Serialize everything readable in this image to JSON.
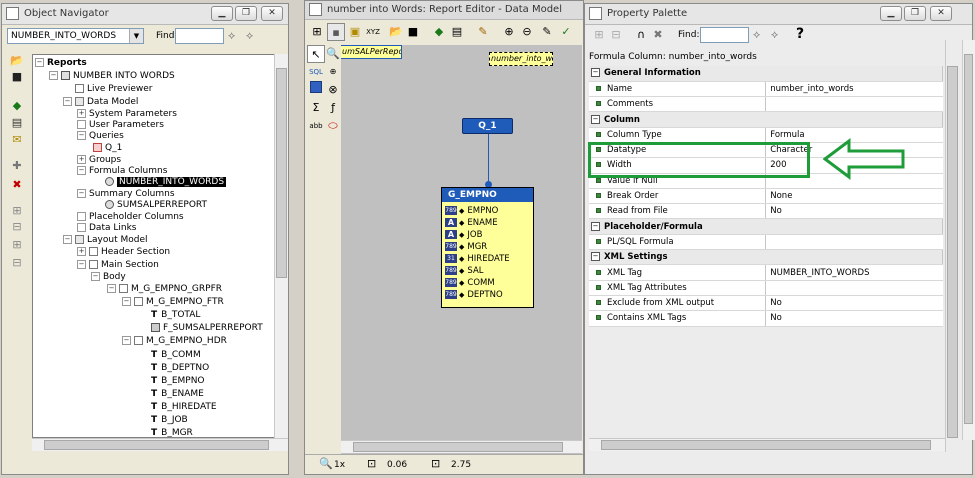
{
  "object_navigator": {
    "title": "Object Navigator",
    "combo_value": "NUMBER_INTO_WORDS",
    "find_label": "Find:",
    "find_value": "",
    "tree": [
      {
        "label": "Reports",
        "bold": true
      },
      {
        "label": "NUMBER INTO WORDS"
      },
      {
        "label": "Live Previewer"
      },
      {
        "label": "Data Model"
      },
      {
        "label": "System Parameters"
      },
      {
        "label": "User Parameters"
      },
      {
        "label": "Queries"
      },
      {
        "label": "Q_1"
      },
      {
        "label": "Groups"
      },
      {
        "label": "Formula Columns"
      },
      {
        "label": "NUMBER_INTO_WORDS",
        "selected": true
      },
      {
        "label": "Summary Columns"
      },
      {
        "label": "SUMSALPERREPORT"
      },
      {
        "label": "Placeholder Columns"
      },
      {
        "label": "Data Links"
      },
      {
        "label": "Layout Model"
      },
      {
        "label": "Header Section"
      },
      {
        "label": "Main Section"
      },
      {
        "label": "Body"
      },
      {
        "label": "M_G_EMPNO_GRPFR"
      },
      {
        "label": "M_G_EMPNO_FTR"
      },
      {
        "label": "B_TOTAL"
      },
      {
        "label": "F_SUMSALPERREPORT"
      },
      {
        "label": "M_G_EMPNO_HDR"
      },
      {
        "label": "B_COMM"
      },
      {
        "label": "B_DEPTNO"
      },
      {
        "label": "B_EMPNO"
      },
      {
        "label": "B_ENAME"
      },
      {
        "label": "B_HIREDATE"
      },
      {
        "label": "B_JOB"
      },
      {
        "label": "B_MGR"
      }
    ]
  },
  "report_editor": {
    "title": "number into Words: Report Editor - Data Model",
    "summary_field": "umSALPerRepo",
    "formula_field": "number_into_wor",
    "query_label": "Q_1",
    "group_title": "G_EMPNO",
    "columns": [
      {
        "name": "EMPNO",
        "type": "789"
      },
      {
        "name": "ENAME",
        "type": "A"
      },
      {
        "name": "JOB",
        "type": "A"
      },
      {
        "name": "MGR",
        "type": "789"
      },
      {
        "name": "HIREDATE",
        "type": "31"
      },
      {
        "name": "SAL",
        "type": "789"
      },
      {
        "name": "COMM",
        "type": "789"
      },
      {
        "name": "DEPTNO",
        "type": "789"
      }
    ],
    "status": {
      "zoom": "1x",
      "x": "0.06",
      "y": "2.75"
    },
    "toolbar_labels": {
      "sql": "SQL",
      "xyz": "XYZ",
      "abb": "abb"
    }
  },
  "property_palette": {
    "title": "Property Palette",
    "find_label": "Find:",
    "find_value": "",
    "object_label": "Formula Column: number_into_words",
    "rows": [
      {
        "type": "section",
        "label": "General Information"
      },
      {
        "type": "prop",
        "label": "Name",
        "value": "number_into_words"
      },
      {
        "type": "prop",
        "label": "Comments",
        "value": ""
      },
      {
        "type": "section",
        "label": "Column"
      },
      {
        "type": "prop",
        "label": "Column Type",
        "value": "Formula"
      },
      {
        "type": "prop",
        "label": "Datatype",
        "value": "Character"
      },
      {
        "type": "prop",
        "label": "Width",
        "value": "200"
      },
      {
        "type": "prop",
        "label": "Value if Null",
        "value": ""
      },
      {
        "type": "prop",
        "label": "Break Order",
        "value": "None"
      },
      {
        "type": "prop",
        "label": "Read from File",
        "value": "No"
      },
      {
        "type": "section",
        "label": "Placeholder/Formula"
      },
      {
        "type": "prop",
        "label": "PL/SQL Formula",
        "value": ""
      },
      {
        "type": "section",
        "label": "XML Settings"
      },
      {
        "type": "prop",
        "label": "XML Tag",
        "value": "NUMBER_INTO_WORDS"
      },
      {
        "type": "prop",
        "label": "XML Tag Attributes",
        "value": ""
      },
      {
        "type": "prop",
        "label": "Exclude from XML output",
        "value": "No"
      },
      {
        "type": "prop",
        "label": "Contains XML Tags",
        "value": "No"
      }
    ]
  },
  "colors": {
    "highlight": "#1e9c3a",
    "group_header": "#1f5bb9",
    "group_body": "#ffff99",
    "canvas": "#c0c0c0"
  }
}
